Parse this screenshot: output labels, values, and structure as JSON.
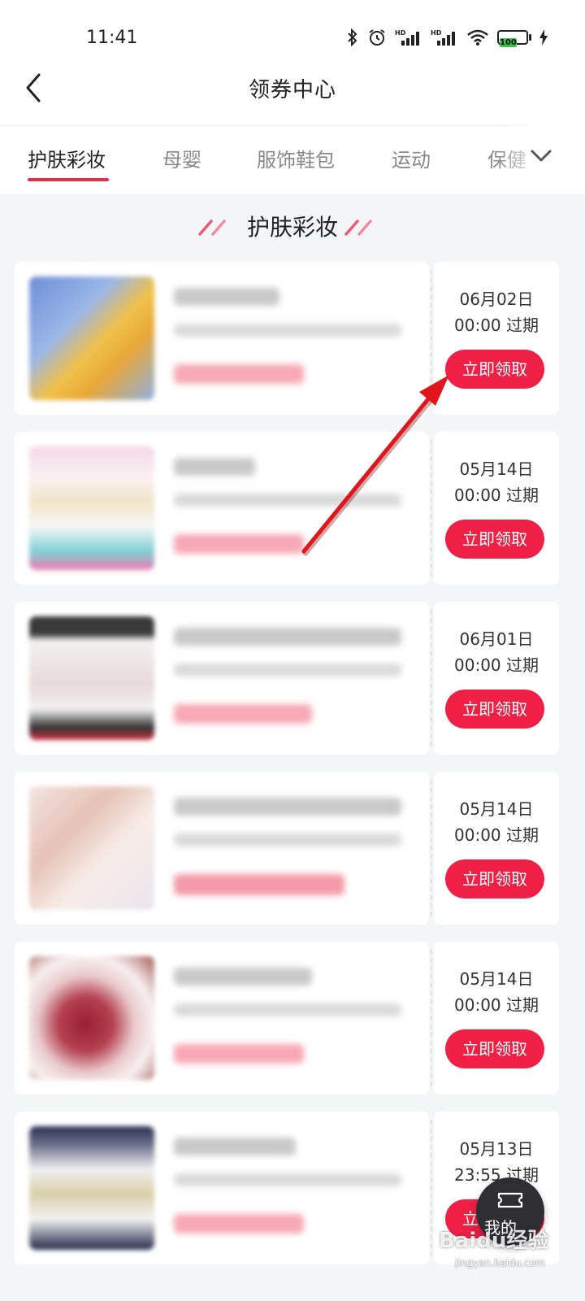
{
  "status_bar": {
    "time": "11:41",
    "battery_level": "100",
    "icons": [
      "bluetooth-icon",
      "alarm-icon",
      "hd-signal-icon",
      "hd-signal-icon",
      "wifi-icon",
      "battery-icon",
      "charging-icon"
    ]
  },
  "header": {
    "title": "领券中心",
    "back_icon": "back-arrow-icon"
  },
  "tabs": {
    "items": [
      {
        "label": "护肤彩妆",
        "active": true
      },
      {
        "label": "母婴",
        "active": false
      },
      {
        "label": "服饰鞋包",
        "active": false
      },
      {
        "label": "运动",
        "active": false
      },
      {
        "label": "保健",
        "active": false
      }
    ],
    "more_icon": "chevron-down-icon"
  },
  "section": {
    "title": "护肤彩妆"
  },
  "coupons": [
    {
      "expire_date": "06月02日",
      "expire_time": "00:00 过期",
      "button_label": "立即领取"
    },
    {
      "expire_date": "05月14日",
      "expire_time": "00:00 过期",
      "button_label": "立即领取"
    },
    {
      "expire_date": "06月01日",
      "expire_time": "00:00 过期",
      "button_label": "立即领取"
    },
    {
      "expire_date": "05月14日",
      "expire_time": "00:00 过期",
      "button_label": "立即领取"
    },
    {
      "expire_date": "05月14日",
      "expire_time": "00:00 过期",
      "button_label": "立即领取"
    },
    {
      "expire_date": "05月13日",
      "expire_time": "23:55 过期",
      "button_label": "立即领取"
    }
  ],
  "floating": {
    "label": "我的",
    "icon": "coupon-ticket-icon"
  },
  "watermark": {
    "text": "Baidu经验",
    "sub": "jingyan.baidu.com"
  },
  "colors": {
    "accent": "#ef1f45",
    "annotation_arrow": "#e0161c"
  }
}
